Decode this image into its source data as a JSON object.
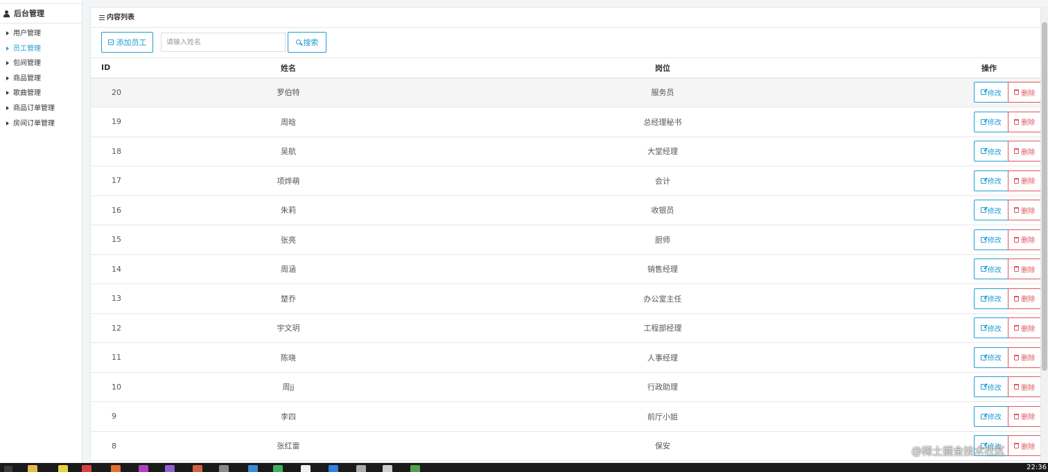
{
  "sidebar": {
    "title": "后台管理",
    "items": [
      {
        "label": "用户管理"
      },
      {
        "label": "员工管理",
        "active": true
      },
      {
        "label": "包间管理"
      },
      {
        "label": "商品管理"
      },
      {
        "label": "歌曲管理"
      },
      {
        "label": "商品订单管理"
      },
      {
        "label": "房间订单管理"
      }
    ]
  },
  "panel": {
    "title": "内容列表",
    "add_button_label": "添加员工",
    "search_placeholder": "请输入姓名",
    "search_value": "",
    "search_button_label": "搜索"
  },
  "table": {
    "columns": [
      "ID",
      "姓名",
      "岗位",
      "操作"
    ],
    "edit_label": "修改",
    "delete_label": "删除",
    "rows": [
      {
        "id": "20",
        "name": "罗伯特",
        "post": "服务员"
      },
      {
        "id": "19",
        "name": "周晗",
        "post": "总经理秘书"
      },
      {
        "id": "18",
        "name": "吴航",
        "post": "大堂经理"
      },
      {
        "id": "17",
        "name": "项烨萌",
        "post": "会计"
      },
      {
        "id": "16",
        "name": "朱莉",
        "post": "收银员"
      },
      {
        "id": "15",
        "name": "张亮",
        "post": "厨师"
      },
      {
        "id": "14",
        "name": "周涵",
        "post": "销售经理"
      },
      {
        "id": "13",
        "name": "楚乔",
        "post": "办公室主任"
      },
      {
        "id": "12",
        "name": "宇文玥",
        "post": "工程部经理"
      },
      {
        "id": "11",
        "name": "陈晓",
        "post": "人事经理"
      },
      {
        "id": "10",
        "name": "周jj",
        "post": "行政助理"
      },
      {
        "id": "9",
        "name": "李四",
        "post": "前厅小姐"
      },
      {
        "id": "8",
        "name": "张红雷",
        "post": "保安"
      }
    ]
  },
  "taskbar": {
    "clock": "22:36"
  },
  "watermark": "@稀土掘金技术社区",
  "colors": {
    "accent": "#1e9ed6",
    "danger": "#e0545f",
    "row_highlight": "#f5f5f5"
  }
}
